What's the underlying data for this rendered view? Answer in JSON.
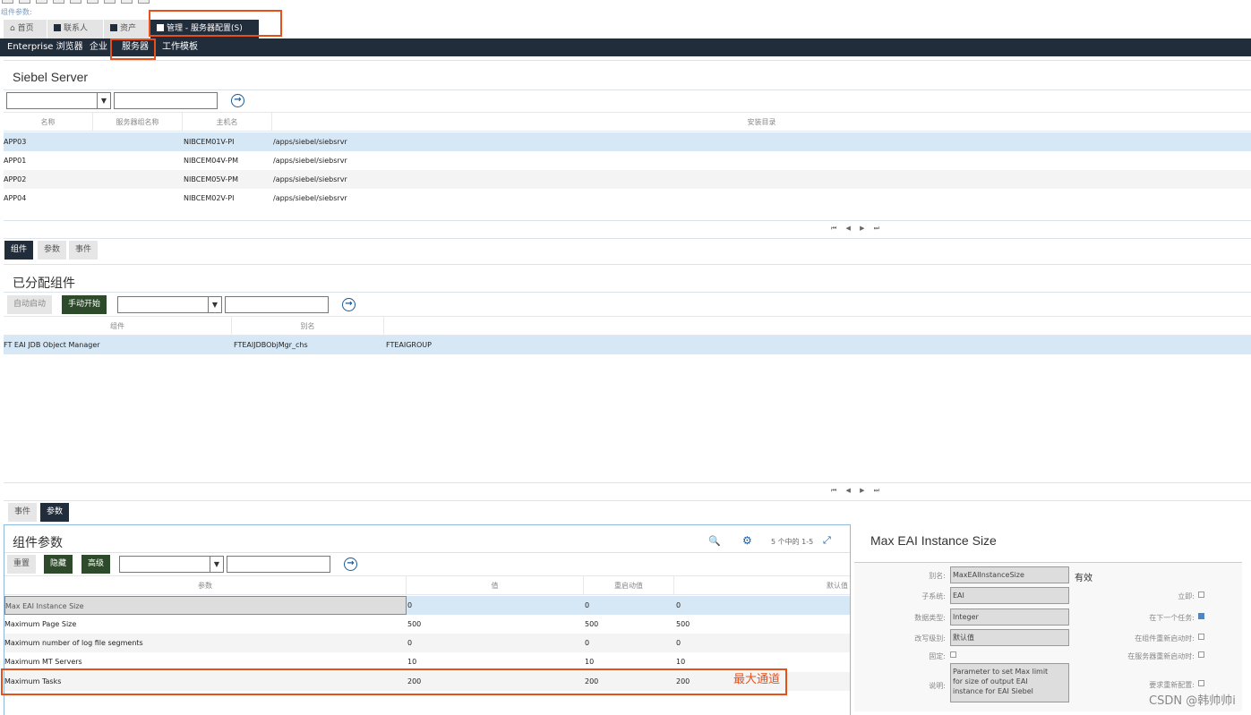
{
  "header": {
    "crumb": "组件参数:"
  },
  "tabs": [
    {
      "label": "首页"
    },
    {
      "label": "联系人"
    },
    {
      "label": "资产"
    },
    {
      "label": "管理 - 服务器配置(S)"
    }
  ],
  "nav": [
    "Enterprise 浏览器",
    "企业",
    "服务器",
    "工作模板"
  ],
  "server": {
    "title": "Siebel Server",
    "columns": [
      "名称",
      "服务器组名称",
      "主机名",
      "安装目录"
    ],
    "rows": [
      {
        "name": "APP03",
        "group": "",
        "host": "NIBCEM01V-PI",
        "dir": "/apps/siebel/siebsrvr"
      },
      {
        "name": "APP01",
        "group": "",
        "host": "NIBCEM04V-PM",
        "dir": "/apps/siebel/siebsrvr"
      },
      {
        "name": "APP02",
        "group": "",
        "host": "NIBCEM05V-PM",
        "dir": "/apps/siebel/siebsrvr"
      },
      {
        "name": "APP04",
        "group": "",
        "host": "NIBCEM02V-PI",
        "dir": "/apps/siebel/siebsrvr"
      }
    ]
  },
  "subtabs1": [
    "组件",
    "参数",
    "事件"
  ],
  "assigned": {
    "title": "已分配组件",
    "btn_auto": "自动启动",
    "btn_manual": "手动开始",
    "columns": [
      "组件",
      "别名"
    ],
    "rows": [
      {
        "comp": "FT EAI JDB Object Manager",
        "alias": "FTEAIJDBObjMgr_chs",
        "group": "FTEAIGROUP"
      }
    ]
  },
  "pager": "⏮ ◀ ▶ ⏭",
  "subtabs2": [
    "事件",
    "参数"
  ],
  "params": {
    "title": "组件参数",
    "count": "5 个中的 1-5",
    "btn_reset": "重置",
    "btn_hide": "隐藏",
    "btn_adv": "高级",
    "columns": [
      "参数",
      "值",
      "重启动值",
      "默认值"
    ],
    "rows": [
      {
        "p": "Max EAI Instance Size",
        "v": "0",
        "r": "0",
        "d": "0"
      },
      {
        "p": "Maximum Page Size",
        "v": "500",
        "r": "500",
        "d": "500"
      },
      {
        "p": "Maximum number of log file segments",
        "v": "0",
        "r": "0",
        "d": "0"
      },
      {
        "p": "Maximum MT Servers",
        "v": "10",
        "r": "10",
        "d": "10"
      },
      {
        "p": "Maximum Tasks",
        "v": "200",
        "r": "200",
        "d": "200"
      }
    ],
    "annotation": "最大通道"
  },
  "detail": {
    "title": "Max EAI Instance Size",
    "alias_label": "别名:",
    "alias": "MaxEAIInstanceSize",
    "status": "有效",
    "subsys_label": "子系统:",
    "subsys": "EAI",
    "type_label": "数据类型:",
    "type": "Integer",
    "level_label": "改写级别:",
    "level": "默认值",
    "fixed_label": "固定:",
    "desc_label": "说明:",
    "desc": "Parameter to set Max limit for size of output EAI instance for EAI Siebel",
    "immediate": "立即:",
    "next_task": "在下一个任务:",
    "comp_restart": "在组件重新启动时:",
    "server_restart": "在服务器重新启动时:",
    "require_reconfig": "要求重新配置:"
  },
  "watermark": "CSDN @韩帅帅i"
}
